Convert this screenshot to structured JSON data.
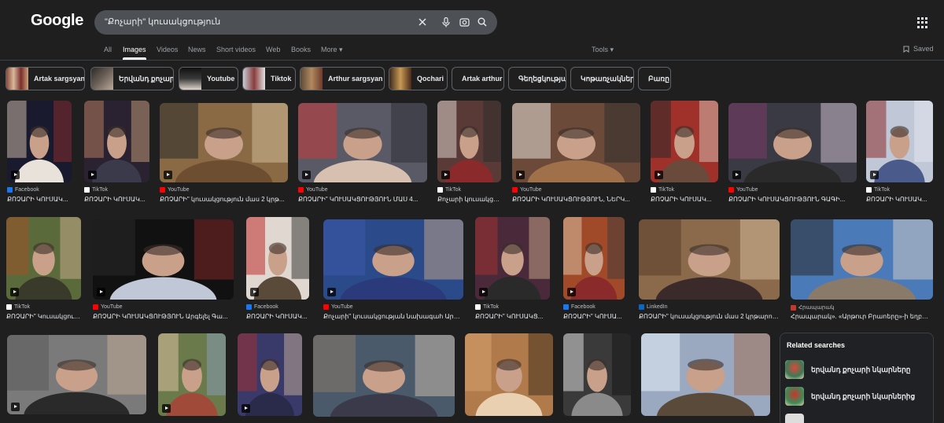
{
  "logo": "Google",
  "search": {
    "query": "\"Քոչարի\" կուսակցություն"
  },
  "tabs": [
    {
      "label": "All",
      "active": false
    },
    {
      "label": "Images",
      "active": true
    },
    {
      "label": "Videos",
      "active": false
    },
    {
      "label": "News",
      "active": false
    },
    {
      "label": "Short videos",
      "active": false
    },
    {
      "label": "Web",
      "active": false
    },
    {
      "label": "Books",
      "active": false
    },
    {
      "label": "More",
      "active": false
    }
  ],
  "tools_label": "Tools",
  "saved_label": "Saved",
  "chips": [
    {
      "label": "Artak sargsyan",
      "thumb": true
    },
    {
      "label": "Երվանդ քոչարի",
      "thumb": true
    },
    {
      "label": "Youtube",
      "thumb": true
    },
    {
      "label": "Tiktok",
      "thumb": true
    },
    {
      "label": "Arthur sargsyan",
      "thumb": true
    },
    {
      "label": "Qochari",
      "thumb": true
    },
    {
      "label": "Artak arthur",
      "thumb": false
    },
    {
      "label": "Գեղեցկության",
      "thumb": false
    },
    {
      "label": "Կոթառչակներ",
      "thumb": false
    },
    {
      "label": "Բառը",
      "thumb": false
    }
  ],
  "images": [
    {
      "source": "Facebook",
      "title": "ՔՈՉԱՐԻ ԿՈՒՍԱԿ...",
      "video": true,
      "source_color": "#1877f2"
    },
    {
      "source": "TikTok",
      "title": "ՔՈՉԱՐԻ ԿՈՒՍԱԿ...",
      "video": true,
      "source_color": "#ffffff"
    },
    {
      "source": "YouTube",
      "title": "ՔՈՉԱՐԻ\" կուսակցություն մաս 2 կրթ...",
      "video": true,
      "source_color": "#ff0000"
    },
    {
      "source": "YouTube",
      "title": "ՔՈՉԱՐԻ\" ԿՈՒՍԱԿՑՈՒԹՅՈՒՆ ՄԱՍ 4...",
      "video": true,
      "source_color": "#ff0000"
    },
    {
      "source": "TikTok",
      "title": "Քոչարի կուսակցութ...",
      "video": true,
      "source_color": "#ffffff"
    },
    {
      "source": "YouTube",
      "title": "ՔՈՉԱՐԻ ԿՈՒՍԱԿՑՈՒԹՅՈՒՆ, ՆԵՐԿ...",
      "video": true,
      "source_color": "#ff0000"
    },
    {
      "source": "TikTok",
      "title": "ՔՈՉԱՐԻ ԿՈՒՍԱԿ...",
      "video": true,
      "source_color": "#ffffff"
    },
    {
      "source": "YouTube",
      "title": "ՔՈՉԱՐԻ ԿՈՒՍԱԿՑՈՒԹՅՈՒՆ ԳԱԳԻ...",
      "video": true,
      "source_color": "#ff0000"
    },
    {
      "source": "TikTok",
      "title": "ՔՈՉԱՐԻ ԿՈՒՍԱԿ...",
      "video": true,
      "source_color": "#ffffff"
    },
    {
      "source": "TikTok",
      "title": "ՔՈՉԱՐԻ\" Կուսակցութ...",
      "video": true,
      "source_color": "#ffffff"
    },
    {
      "source": "YouTube",
      "title": "ՔՈՉԱՐԻ ԿՈՒՍԱԿՑՈՒԹՅՈՒՆ Արգելել Գա...",
      "video": true,
      "source_color": "#ff0000"
    },
    {
      "source": "Facebook",
      "title": "ՔՈՉԱՐԻ ԿՈՒՍԱԿ...",
      "video": true,
      "source_color": "#1877f2"
    },
    {
      "source": "YouTube",
      "title": "Քոչարի\" կուսակցության նախագահ Արտ...",
      "video": true,
      "source_color": "#ff0000"
    },
    {
      "source": "TikTok",
      "title": "ՔՈՉԱՐԻ\" ԿՈՒՍԱԿՑ...",
      "video": true,
      "source_color": "#ffffff"
    },
    {
      "source": "Facebook",
      "title": "ՔՈՉԱՐԻ\" ԿՈՒՍԱ...",
      "video": true,
      "source_color": "#1877f2"
    },
    {
      "source": "LinkedIn",
      "title": "ՔՈՉԱՐԻ\" կուսակցություն մաս 2 կրթարոց...",
      "video": false,
      "source_color": "#0a66c2"
    },
    {
      "source": "Հրապարակ",
      "title": "Հրապարակ». «Արթուր Բրաոերը»-ի եղբայ...",
      "video": false,
      "source_color": "#c0392b"
    },
    {
      "source": "",
      "title": "",
      "video": true,
      "source_color": "#ffffff"
    },
    {
      "source": "",
      "title": "",
      "video": true,
      "source_color": "#ffffff"
    },
    {
      "source": "",
      "title": "",
      "video": true,
      "source_color": "#ffffff"
    },
    {
      "source": "",
      "title": "",
      "video": false,
      "source_color": "#ffffff"
    },
    {
      "source": "",
      "title": "",
      "video": false,
      "source_color": "#ffffff"
    },
    {
      "source": "",
      "title": "",
      "video": false,
      "source_color": "#ffffff"
    },
    {
      "source": "",
      "title": "",
      "video": false,
      "source_color": "#ffffff"
    }
  ],
  "related": {
    "heading": "Related searches",
    "items": [
      {
        "label": "երվանդ քոչարի նկարները"
      },
      {
        "label": "երվանդ քոչարի նկարներից"
      },
      {
        "label": ""
      }
    ]
  },
  "colors": {
    "background": "#1f1f1f",
    "search_bg": "#4d5156",
    "text": "#e8eaed",
    "muted": "#9aa0a6"
  }
}
